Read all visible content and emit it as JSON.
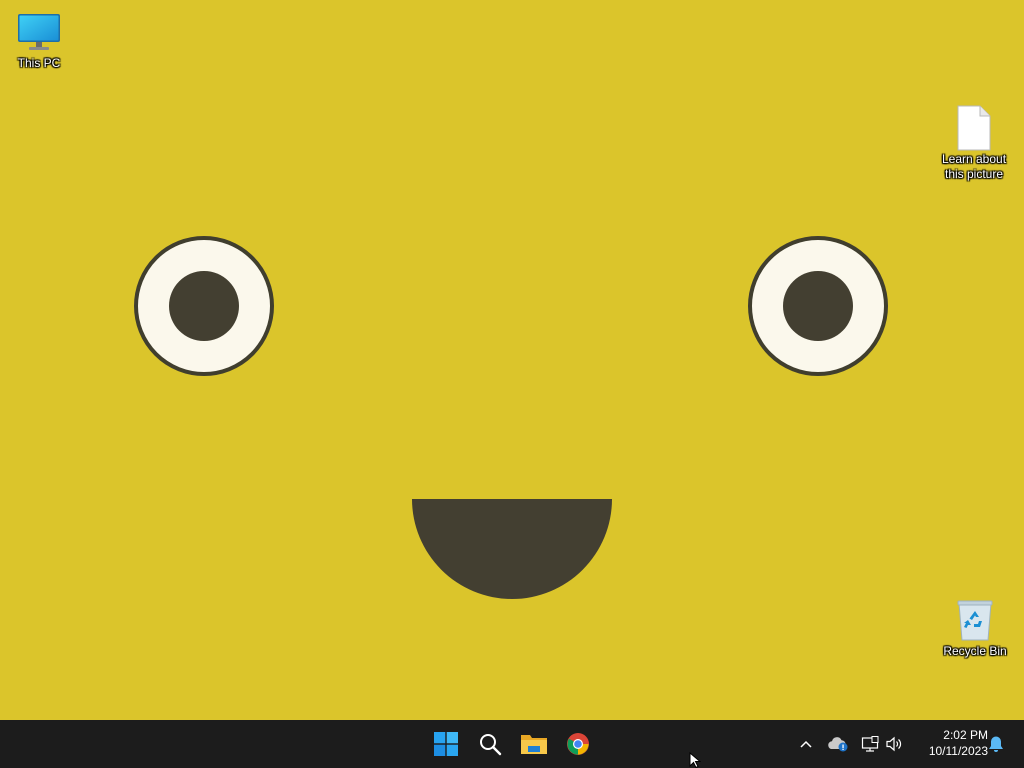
{
  "desktop": {
    "wallpaper_color": "#dbc52b",
    "face_dark_color": "#433f31",
    "eye_white_color": "#fbf8ec",
    "icons": [
      {
        "id": "this-pc",
        "label": "This PC",
        "icon": "monitor-icon"
      },
      {
        "id": "learn",
        "label": "Learn about\nthis picture",
        "icon": "document-icon"
      },
      {
        "id": "recycle",
        "label": "Recycle Bin",
        "icon": "recycle-bin-icon"
      }
    ]
  },
  "taskbar": {
    "background": "#1c1c1c",
    "apps": [
      {
        "name": "Start",
        "icon": "windows-logo-icon"
      },
      {
        "name": "Search",
        "icon": "search-icon"
      },
      {
        "name": "File Explorer",
        "icon": "folder-icon"
      },
      {
        "name": "Google Chrome",
        "icon": "chrome-icon"
      }
    ],
    "tray": {
      "icons": [
        "chevron-up-icon",
        "onedrive-icon",
        "network-icon",
        "volume-icon",
        "notification-bell-icon"
      ],
      "time": "2:02 PM",
      "date": "10/11/2023"
    }
  }
}
